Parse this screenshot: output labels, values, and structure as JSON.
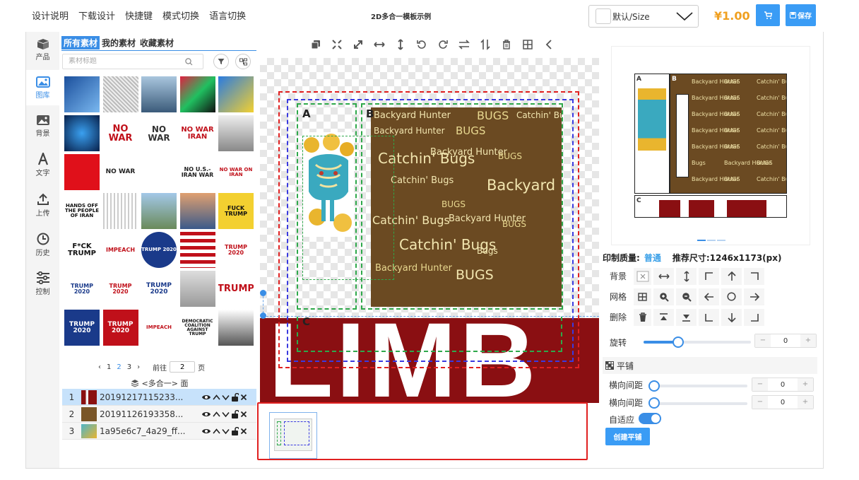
{
  "menu": {
    "items": [
      "设计说明",
      "下载设计",
      "快捷键",
      "模式切换",
      "语言切换"
    ]
  },
  "app_title": "2D多合一模板示例",
  "size_select": {
    "value": "默认/Size"
  },
  "price": "¥1.00",
  "save_label": "保存",
  "nav": {
    "items": [
      {
        "label": "产品",
        "icon": "product-box-icon"
      },
      {
        "label": "图库",
        "icon": "image-library-icon"
      },
      {
        "label": "背景",
        "icon": "background-image-icon"
      },
      {
        "label": "文字",
        "icon": "text-icon"
      },
      {
        "label": "上传",
        "icon": "upload-icon"
      },
      {
        "label": "历史",
        "icon": "history-clock-icon"
      },
      {
        "label": "控制",
        "icon": "sliders-icon"
      }
    ]
  },
  "assets": {
    "tabs": [
      "所有素材",
      "我的素材",
      "收藏素材"
    ],
    "search_placeholder": "素材标题"
  },
  "thumbs": [
    {
      "t": ""
    },
    {
      "t": ""
    },
    {
      "t": ""
    },
    {
      "t": ""
    },
    {
      "t": ""
    },
    {
      "t": ""
    },
    {
      "t": "NO WAR"
    },
    {
      "t": "NO WAR"
    },
    {
      "t": "NO WAR IRAN"
    },
    {
      "t": ""
    },
    {
      "t": ""
    },
    {
      "t": "NO WAR"
    },
    {
      "t": ""
    },
    {
      "t": "NO U.S.-IRAN WAR"
    },
    {
      "t": "NO WAR ON IRAN"
    },
    {
      "t": "HANDS OFF THE PEOPLE OF IRAN"
    },
    {
      "t": ""
    },
    {
      "t": ""
    },
    {
      "t": ""
    },
    {
      "t": "FUCK TRUMP"
    },
    {
      "t": "F*CK TRUMP"
    },
    {
      "t": "IMPEACH"
    },
    {
      "t": "TRUMP 2020"
    },
    {
      "t": ""
    },
    {
      "t": "TRUMP 2020"
    },
    {
      "t": "TRUMP 2020"
    },
    {
      "t": "TRUMP 2020"
    },
    {
      "t": "TRUMP 2020"
    },
    {
      "t": ""
    },
    {
      "t": "TRUMP"
    },
    {
      "t": "TRUMP 2020"
    },
    {
      "t": "TRUMP 2020"
    },
    {
      "t": "IMPEACH"
    },
    {
      "t": "DEMOCRATIC COALITION AGAINST TRUMP"
    },
    {
      "t": ""
    }
  ],
  "pager": {
    "prev": "‹",
    "pages": [
      "1",
      "2",
      "3"
    ],
    "next": "›",
    "goto_label": "前往",
    "goto_value": "2",
    "page_unit": "页"
  },
  "layers": {
    "header": "<多合一> 面",
    "items": [
      {
        "num": "1",
        "name": "20191217115233..."
      },
      {
        "num": "2",
        "name": "20191126193358..."
      },
      {
        "num": "3",
        "name": "1a95e6c7_4a29_ff..."
      }
    ]
  },
  "canvas": {
    "area_a": "A",
    "area_b": "B",
    "area_c": "C",
    "pattern_words": [
      "Backyard Hunter",
      "BUGS",
      "Catchin' Bugs",
      "Backyard Hunter",
      "BUGS",
      "Catchin' Bugs",
      "Backyard Hunter",
      "BUGS",
      "Catchin' Bugs",
      "Backyard Hunter",
      "BUGS",
      "Catchin' Bugs",
      "Backyard Hunter",
      "BUGS",
      "Catchin' Bugs",
      "Bugs",
      "Backyard Hunter",
      "BUGS"
    ],
    "band_text": "LIMB"
  },
  "print_quality": {
    "label": "印制质量:",
    "value": "普通",
    "recommend": "推荐尺寸:1246x1173(px)"
  },
  "controls": {
    "background": "背景",
    "grid": "网格",
    "delete": "删除"
  },
  "rotate": {
    "label": "旋转",
    "value": "0",
    "fraction": 0.22
  },
  "tile": {
    "header": "平铺",
    "h_label": "横向间距",
    "v_label": "横向间距",
    "h_value": "0",
    "v_value": "0",
    "auto_fit": "自适应",
    "create_btn": "创建平铺"
  },
  "colors": {
    "accent": "#3a8ee6",
    "price": "#f0a020",
    "brand_button": "#3a9cf5",
    "highlight_border": "#e02020"
  }
}
